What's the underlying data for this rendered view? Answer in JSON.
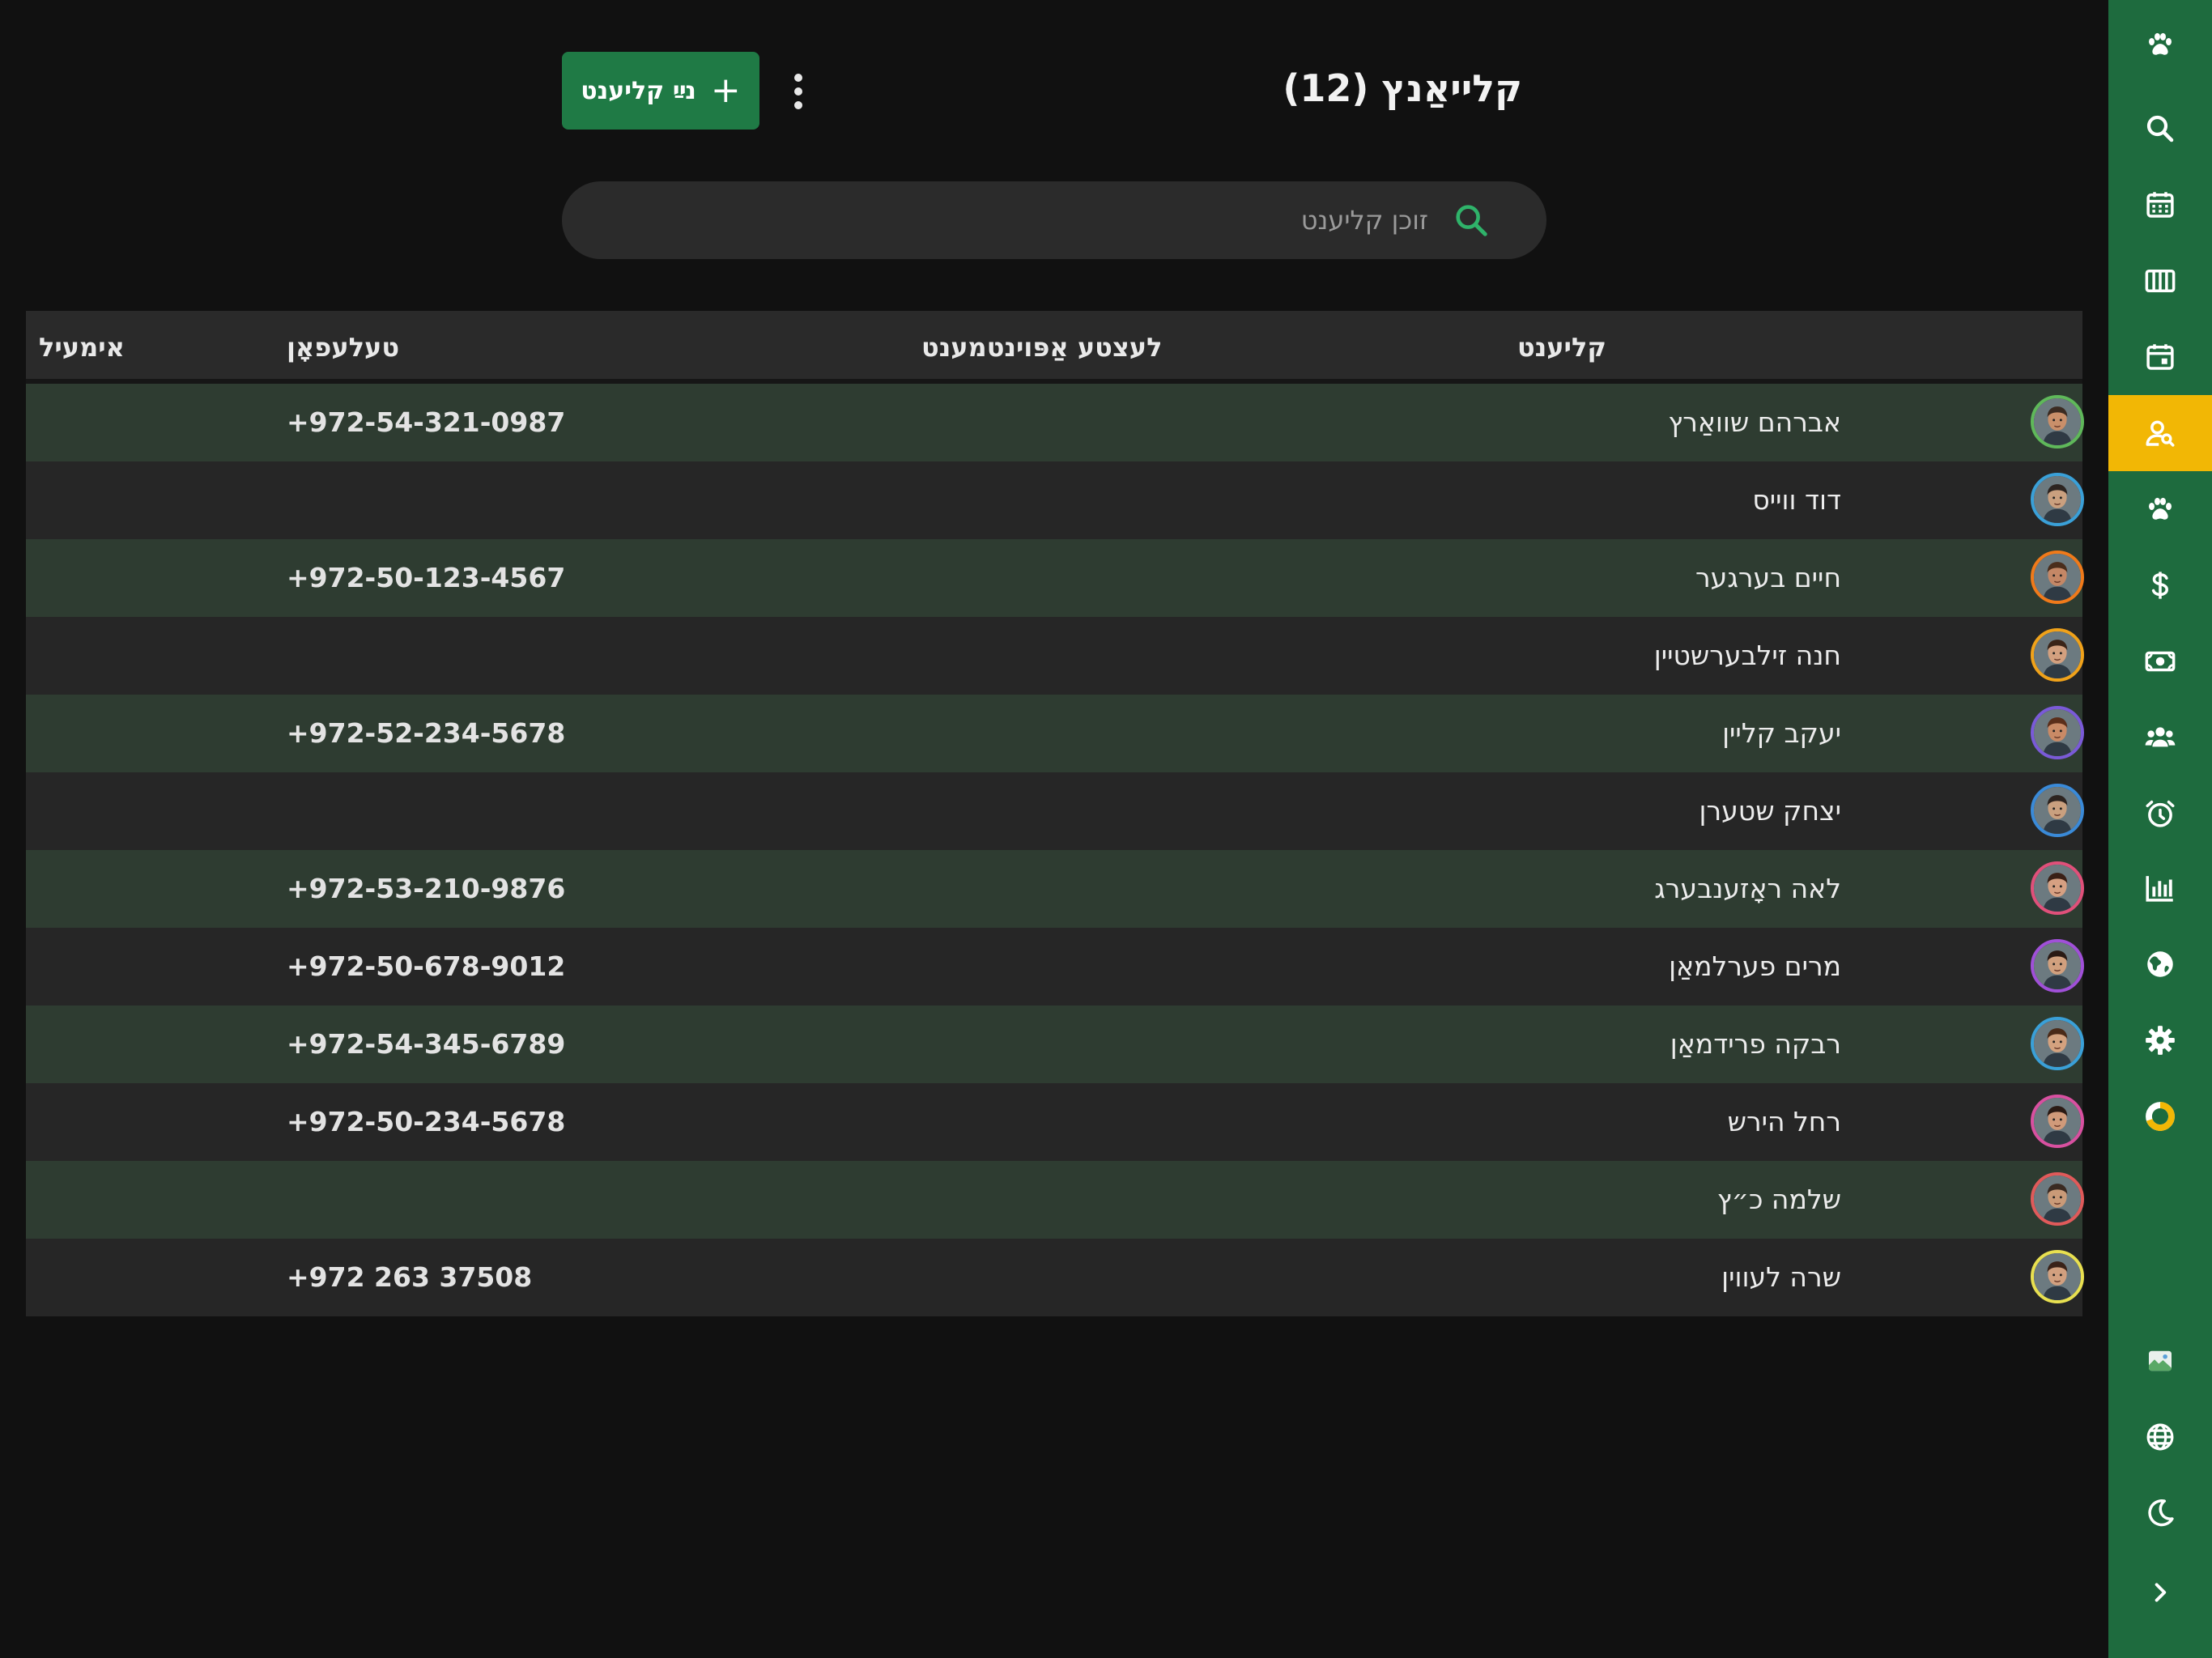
{
  "header": {
    "title": "קלייאַנץ (12)",
    "add_label": "נײַ קליענט",
    "add_icon": "plus-icon",
    "more_icon": "more-vertical-icon"
  },
  "search": {
    "placeholder": "זוכן קליענט",
    "value": "",
    "icon": "search-icon"
  },
  "table": {
    "columns": {
      "client": "קליענט",
      "next_appointment": "לעצטע אַפּוינטמענט",
      "phone": "טעלעפאָן",
      "email": "אימעיל"
    },
    "rows": [
      {
        "name": "אברהם שוואַרץ",
        "phone": "+972-54-321-0987",
        "email": "",
        "appointment": "",
        "ring": "#5fb85a",
        "skin": "#c98f6a",
        "hair": "#3b2b22"
      },
      {
        "name": "דוד ווייס",
        "phone": "",
        "email": "",
        "appointment": "",
        "ring": "#3aa0d8",
        "skin": "#caa07f",
        "hair": "#2d2420"
      },
      {
        "name": "חיים בערגער",
        "phone": "+972-50-123-4567",
        "email": "",
        "appointment": "",
        "ring": "#f07a1a",
        "skin": "#c48766",
        "hair": "#4a2d1c"
      },
      {
        "name": "חנה זילבערשטיין",
        "phone": "",
        "email": "",
        "appointment": "",
        "ring": "#f0a21a",
        "skin": "#d3a07f",
        "hair": "#3a2418"
      },
      {
        "name": "יעקב קליין",
        "phone": "+972-52-234-5678",
        "email": "",
        "appointment": "",
        "ring": "#7a5ad8",
        "skin": "#c98a66",
        "hair": "#5a2e1a"
      },
      {
        "name": "יצחק שטערן",
        "phone": "",
        "email": "",
        "appointment": "",
        "ring": "#3a8ad8",
        "skin": "#c9a07f",
        "hair": "#2d2420"
      },
      {
        "name": "לאה ראָזענבערג",
        "phone": "+972-53-210-9876",
        "email": "",
        "appointment": "",
        "ring": "#e0507a",
        "skin": "#d6a082",
        "hair": "#3a2016"
      },
      {
        "name": "מרים פערלמאַן",
        "phone": "+972-50-678-9012",
        "email": "",
        "appointment": "",
        "ring": "#a050d8",
        "skin": "#d1a07e",
        "hair": "#2a1a14"
      },
      {
        "name": "רבקה פרידמאַן",
        "phone": "+972-54-345-6789",
        "email": "",
        "appointment": "",
        "ring": "#3aa0d8",
        "skin": "#d4a27f",
        "hair": "#4a2a18"
      },
      {
        "name": "רחל הירש",
        "phone": "+972-50-234-5678",
        "email": "",
        "appointment": "",
        "ring": "#d850a0",
        "skin": "#d09a7a",
        "hair": "#2a1a14"
      },
      {
        "name": "שלמה כ״ץ",
        "phone": "",
        "email": "",
        "appointment": "",
        "ring": "#e05a5a",
        "skin": "#c99a78",
        "hair": "#3a2a22"
      },
      {
        "name": "שרה לעווין",
        "phone": "+972 263 37508",
        "email": "",
        "appointment": "",
        "ring": "#e8e050",
        "skin": "#d2a07f",
        "hair": "#3a2218"
      }
    ]
  },
  "sidebar": {
    "accent": "#f2b705",
    "background": "#1e6b3e",
    "active_item": "clients",
    "items": [
      {
        "id": "logo",
        "icon": "paw-icon"
      },
      {
        "id": "search",
        "icon": "search-icon"
      },
      {
        "id": "calendar",
        "icon": "calendar-grid-icon"
      },
      {
        "id": "board",
        "icon": "columns-icon"
      },
      {
        "id": "appointments",
        "icon": "calendar-day-icon"
      },
      {
        "id": "clients",
        "icon": "user-search-icon"
      },
      {
        "id": "pets",
        "icon": "paw-icon"
      },
      {
        "id": "pricing",
        "icon": "dollar-icon"
      },
      {
        "id": "payments",
        "icon": "banknote-icon"
      },
      {
        "id": "team",
        "icon": "users-icon"
      },
      {
        "id": "reminders",
        "icon": "alarm-icon"
      },
      {
        "id": "reports",
        "icon": "bar-chart-icon"
      },
      {
        "id": "web",
        "icon": "globe-icon"
      },
      {
        "id": "settings",
        "icon": "gear-icon"
      },
      {
        "id": "status",
        "icon": "donut-icon"
      },
      {
        "id": "profile",
        "icon": "broken-image-icon"
      },
      {
        "id": "language",
        "icon": "globe-outline-icon"
      },
      {
        "id": "theme",
        "icon": "moon-icon"
      },
      {
        "id": "expand",
        "icon": "chevron-right-icon"
      }
    ]
  }
}
